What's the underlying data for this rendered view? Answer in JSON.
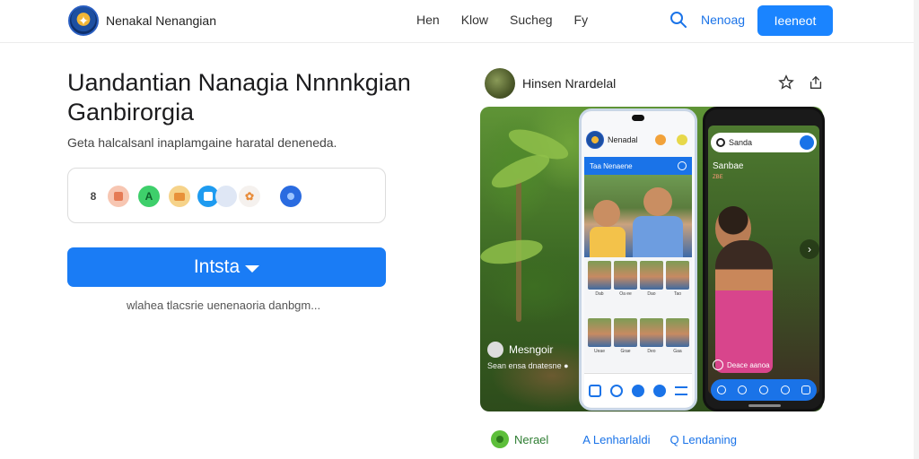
{
  "nav": {
    "brand_name": "Nenakal Nenangian",
    "links": [
      "Hen",
      "Klow",
      "Sucheg",
      "Fy"
    ],
    "login_label": "Nenoag",
    "cta_label": "Ieeneot"
  },
  "hero": {
    "title": "Uandantian Nanagia Nnnnkgian Ganbirorgia",
    "subtitle": "Geta halcalsanl inaplamgaine haratal deneneda.",
    "app_icons": [
      "8",
      "",
      "A",
      "",
      "",
      "",
      ""
    ],
    "install_label": "Intsta",
    "install_note": "wlahea tlacsrie uenenaoria danbgm..."
  },
  "preview": {
    "name": "Hinsen Nrardelal",
    "scene_caption": "Mesngoir",
    "scene_subcaption": "Sean ensa dnatesne   ●",
    "phone1": {
      "app_title": "Nenadal",
      "bar_label": "Taa Nenaene",
      "thumb_captions": [
        "Dab",
        "Oa ee",
        "Dao",
        "Tao",
        "Ueae",
        "Grae",
        "Deo",
        "Gaa"
      ]
    },
    "phone2": {
      "search_text": "Sanda",
      "label": "Sanbae",
      "sublabel": "ZBE",
      "caption": "Deace  aanoa"
    }
  },
  "tags": [
    {
      "label": "Nerael"
    },
    {
      "label": "A Lenharlaldi"
    },
    {
      "label": "Q Lendaning"
    }
  ]
}
